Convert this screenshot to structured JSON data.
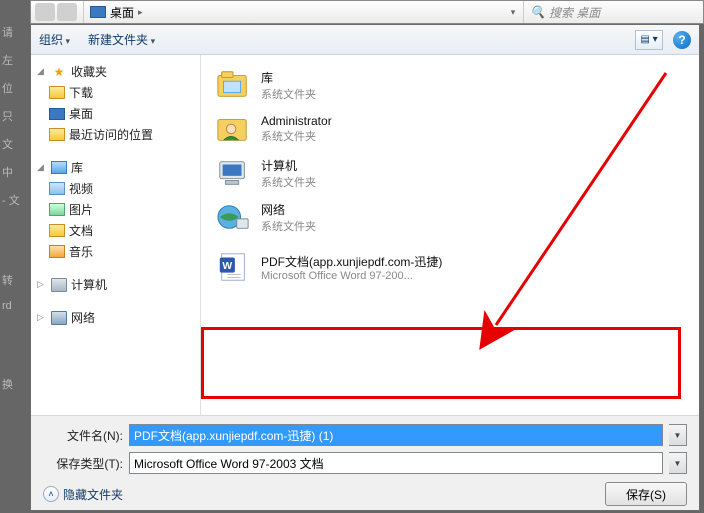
{
  "address": {
    "location": "桌面",
    "search_placeholder": "搜索 桌面"
  },
  "side_hints": [
    "请",
    "左",
    "位",
    "只",
    "文",
    "中",
    "- 文",
    "转",
    "rd",
    "换"
  ],
  "toolbar": {
    "organize": "组织",
    "new_folder": "新建文件夹"
  },
  "sidebar": {
    "favorites": {
      "label": "收藏夹",
      "items": [
        {
          "label": "下载",
          "icon": "dl"
        },
        {
          "label": "桌面",
          "icon": "desk"
        },
        {
          "label": "最近访问的位置",
          "icon": "recent"
        }
      ]
    },
    "libraries": {
      "label": "库",
      "items": [
        {
          "label": "视频",
          "icon": "vid"
        },
        {
          "label": "图片",
          "icon": "pic"
        },
        {
          "label": "文档",
          "icon": "doc"
        },
        {
          "label": "音乐",
          "icon": "mus"
        }
      ]
    },
    "computer": {
      "label": "计算机"
    },
    "network": {
      "label": "网络"
    }
  },
  "content": {
    "items": [
      {
        "title": "库",
        "sub": "系统文件夹",
        "icon": "lib-folder"
      },
      {
        "title": "Administrator",
        "sub": "系统文件夹",
        "icon": "user"
      },
      {
        "title": "计算机",
        "sub": "系统文件夹",
        "icon": "computer"
      },
      {
        "title": "网络",
        "sub": "系统文件夹",
        "icon": "network"
      },
      {
        "title": "PDF文档(app.xunjiepdf.com-迅捷)",
        "sub": "Microsoft Office Word 97-200...",
        "icon": "word"
      }
    ]
  },
  "fields": {
    "filename_label": "文件名(N):",
    "filename_value": "PDF文档(app.xunjiepdf.com-迅捷) (1)",
    "savetype_label": "保存类型(T):",
    "savetype_value": "Microsoft Office Word 97-2003 文档"
  },
  "actions": {
    "hide_folders": "隐藏文件夹",
    "save": "保存(S)"
  }
}
